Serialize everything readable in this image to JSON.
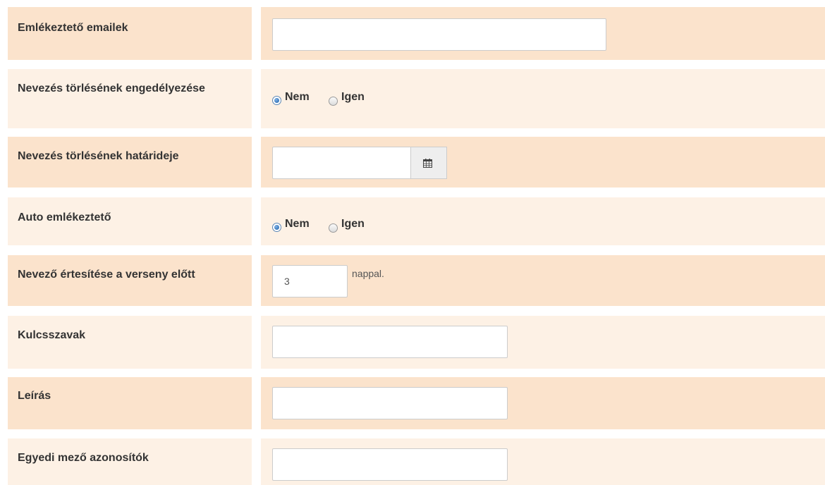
{
  "rows": {
    "reminder_emails": {
      "label": "Emlékeztető emailek",
      "value": ""
    },
    "allow_cancel": {
      "label": "Nevezés törlésének engedélyezése",
      "options": [
        "Nem",
        "Igen"
      ],
      "selected": "Nem"
    },
    "cancel_deadline": {
      "label": "Nevezés törlésének határideje",
      "value": "",
      "icon": "calendar-icon"
    },
    "auto_reminder": {
      "label": "Auto emlékeztető",
      "options": [
        "Nem",
        "Igen"
      ],
      "selected": "Nem"
    },
    "notify_before": {
      "label": "Nevező értesítése a verseny előtt",
      "value": "3",
      "suffix": "nappal."
    },
    "keywords": {
      "label": "Kulcsszavak",
      "value": ""
    },
    "description": {
      "label": "Leírás",
      "value": ""
    },
    "custom_field_ids": {
      "label": "Egyedi mező azonosítók",
      "value": ""
    }
  },
  "colors": {
    "row_dark": "#fbe3cc",
    "row_light": "#fdf1e5",
    "radio_selected": "#1c5ea8"
  }
}
